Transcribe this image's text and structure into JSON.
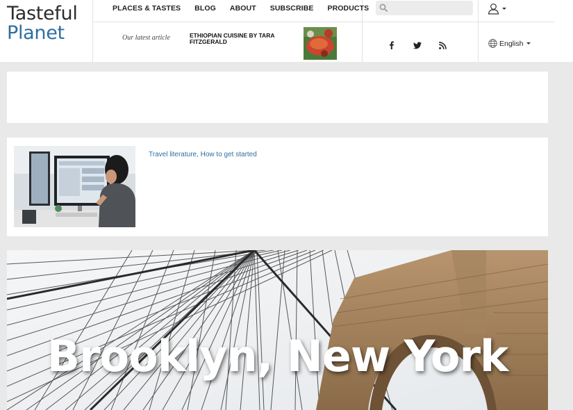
{
  "logo": {
    "line1": "Tasteful",
    "line2": "Planet"
  },
  "nav": [
    {
      "label": "PLACES & TASTES"
    },
    {
      "label": "BLOG"
    },
    {
      "label": "ABOUT"
    },
    {
      "label": "SUBSCRIBE"
    },
    {
      "label": "PRODUCTS"
    }
  ],
  "search": {
    "placeholder": "",
    "value": ""
  },
  "user": {
    "icon": "user-icon"
  },
  "latest": {
    "label": "Our latest article",
    "title": "ETHIOPIAN CUISINE by TARA FITZGERALD"
  },
  "social": [
    "facebook-icon",
    "twitter-icon",
    "rss-icon"
  ],
  "language": {
    "label": "English",
    "icon": "globe-icon"
  },
  "article": {
    "link": "Travel literature, How to get started"
  },
  "hero": {
    "title": "Brooklyn, New York"
  },
  "colors": {
    "brand_blue": "#2d6fa3",
    "page_bg": "#e9e9e9",
    "nav_text": "#222222"
  }
}
